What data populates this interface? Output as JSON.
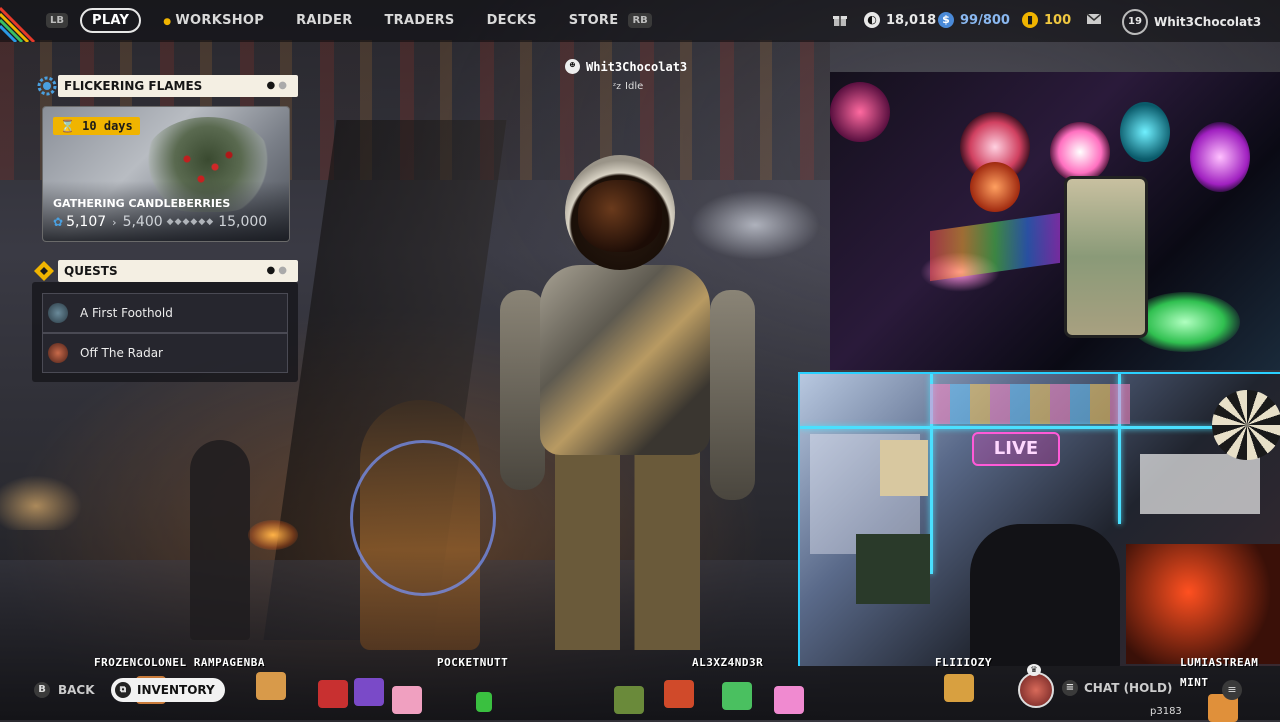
{
  "nav": {
    "lb": "LB",
    "rb": "RB",
    "items": [
      "PLAY",
      "WORKSHOP",
      "RAIDER",
      "TRADERS",
      "DECKS",
      "STORE"
    ],
    "active": "PLAY"
  },
  "currency": {
    "coins": "18,018",
    "cred": "99/800",
    "tokens": "100"
  },
  "profile": {
    "level": "19",
    "username": "Whit3Chocolat3"
  },
  "event": {
    "header": "FLICKERING FLAMES",
    "days": "10 days",
    "title": "GATHERING CANDLEBERRIES",
    "current": "5,107",
    "next": "5,400",
    "max": "15,000"
  },
  "quests": {
    "header": "QUESTS",
    "items": [
      "A First Foothold",
      "Off The Radar"
    ]
  },
  "player": {
    "name": "Whit3Chocolat3",
    "status": "Idle"
  },
  "webcam": {
    "live_sign": "LIVE"
  },
  "chat_overlay": {
    "names": [
      "FROZENCOLONEL RAMPAGENBA",
      "POCKETNUTT",
      "AL3XZ4ND3R",
      "FLIIIOZY",
      "LUMIASTREAM"
    ],
    "mint": "MINT",
    "user_tag": "p3183"
  },
  "bottom": {
    "back_key": "B",
    "back": "BACK",
    "inventory": "INVENTORY",
    "chat_hold": "CHAT (HOLD)"
  },
  "colors": {
    "accent": "#f0b400",
    "panel_header": "#f4efe3",
    "neon": "#4ae0ff"
  }
}
